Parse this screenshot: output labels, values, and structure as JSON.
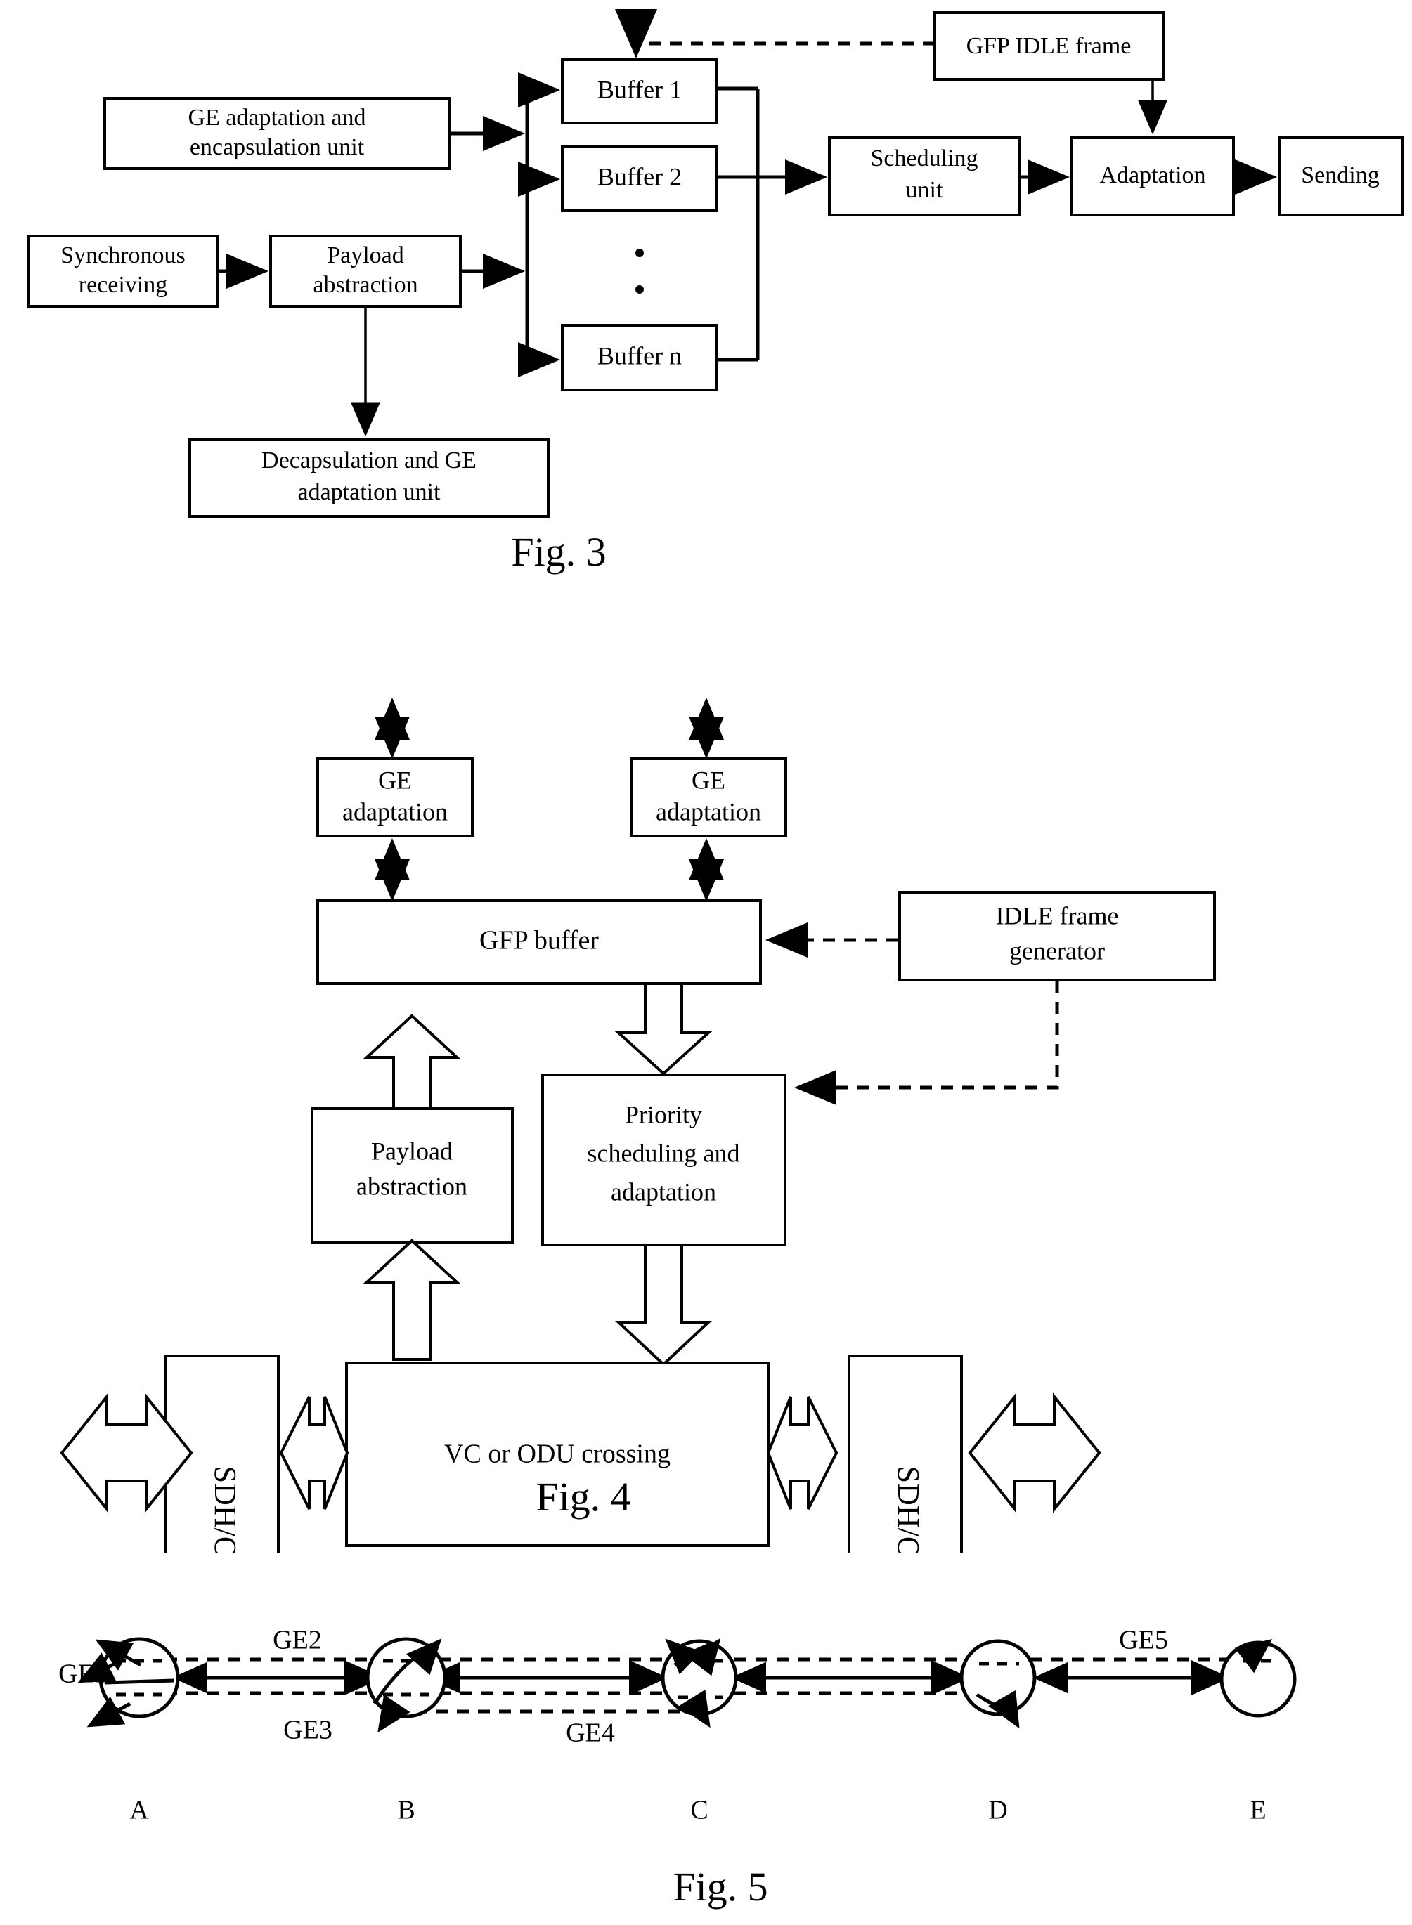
{
  "document": {
    "type": "patent-drawing-sheet",
    "figures": [
      "Fig. 3",
      "Fig. 4",
      "Fig. 5"
    ]
  },
  "fig3": {
    "caption": "Fig. 3",
    "boxes": {
      "ge_adaptation_encapsulation": "GE adaptation and\nencapsulation unit",
      "ge_adaptation_encapsulation_line1": "GE adaptation and",
      "ge_adaptation_encapsulation_line2": "encapsulation unit",
      "synchronous_receiving_line1": "Synchronous",
      "synchronous_receiving_line2": "receiving",
      "payload_abstraction_line1": "Payload",
      "payload_abstraction_line2": "abstraction",
      "decapsulation_line1": "Decapsulation and GE",
      "decapsulation_line2": "adaptation unit",
      "buffer1": "Buffer 1",
      "buffer2": "Buffer 2",
      "buffern": "Buffer n",
      "scheduling_unit_line1": "Scheduling",
      "scheduling_unit_line2": "unit",
      "adaptation": "Adaptation",
      "sending": "Sending",
      "gfp_idle_frame": "GFP IDLE frame"
    },
    "ellipsis": "vertical-dots"
  },
  "fig4": {
    "caption": "Fig. 4",
    "boxes": {
      "ge_adaptation_left_line1": "GE",
      "ge_adaptation_left_line2": "adaptation",
      "ge_adaptation_right_line1": "GE",
      "ge_adaptation_right_line2": "adaptation",
      "gfp_buffer": "GFP buffer",
      "idle_frame_generator_line1": "IDLE frame",
      "idle_frame_generator_line2": "generator",
      "payload_abstraction_line1": "Payload",
      "payload_abstraction_line2": "abstraction",
      "priority_line1": "Priority",
      "priority_line2": "scheduling and",
      "priority_line3": "adaptation",
      "sdh_otn_left": "SDH/OTN",
      "sdh_otn_right": "SDH/OTN",
      "vc_odu_crossing": "VC or ODU crossing"
    }
  },
  "fig5": {
    "caption": "Fig. 5",
    "nodes": [
      "A",
      "B",
      "C",
      "D",
      "E"
    ],
    "links": [
      "GE1",
      "GE2",
      "GE3",
      "GE4",
      "GE5"
    ],
    "link_labels": {
      "ge1": "GE1",
      "ge2": "GE2",
      "ge3": "GE3",
      "ge4": "GE4",
      "ge5": "GE5"
    }
  },
  "colors": {
    "ink": "#000000",
    "paper": "#ffffff"
  }
}
